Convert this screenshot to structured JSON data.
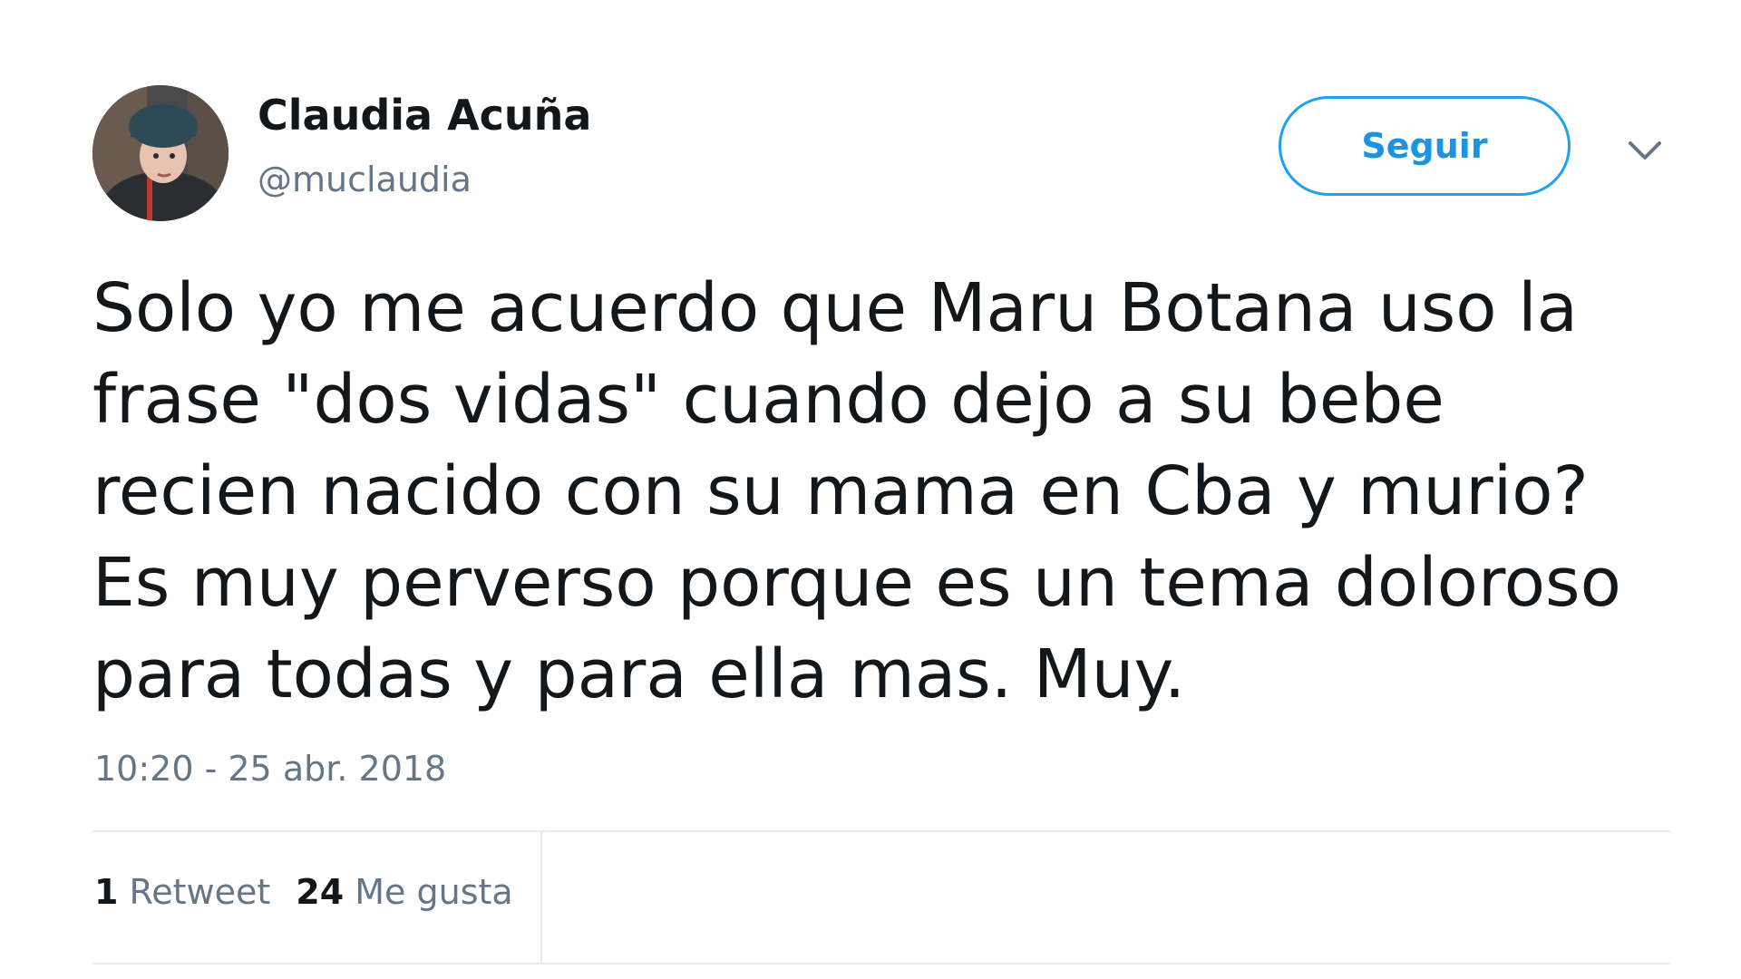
{
  "tweet": {
    "author": {
      "display_name": "Claudia Acuña",
      "handle": "@muclaudia"
    },
    "follow_label": "Seguir",
    "menu_icon": "chevron-down-icon",
    "text_lines": [
      "Solo yo me acuerdo que Maru Botana uso la",
      "frase \"dos vidas\" cuando dejo a su bebe",
      "recien nacido con su mama en Cba y murio?",
      "Es muy perverso porque es un tema doloroso",
      "para todas y para ella mas. Muy."
    ],
    "timestamp": "10:20 - 25 abr. 2018",
    "stats": {
      "retweets_count": "1",
      "retweets_label": "Retweet",
      "likes_count": "24",
      "likes_label": "Me gusta"
    }
  },
  "colors": {
    "text": "#14171a",
    "secondary": "#657786",
    "accent": "#1da1f2",
    "divider": "#e6ecf0"
  }
}
